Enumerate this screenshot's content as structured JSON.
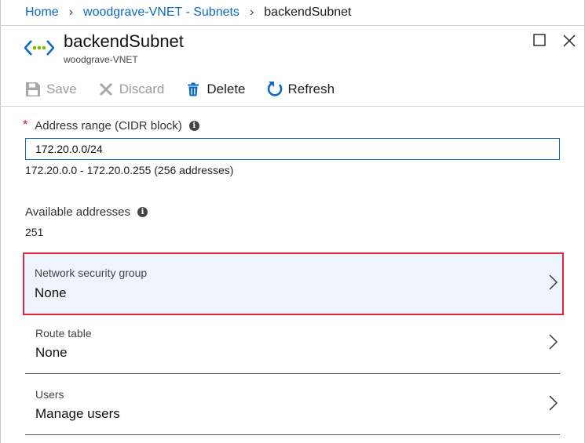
{
  "breadcrumb": {
    "items": [
      "Home",
      "woodgrave-VNET - Subnets",
      "backendSubnet"
    ]
  },
  "header": {
    "title": "backendSubnet",
    "subtitle": "woodgrave-VNET"
  },
  "toolbar": {
    "save_label": "Save",
    "discard_label": "Discard",
    "delete_label": "Delete",
    "refresh_label": "Refresh"
  },
  "address_range": {
    "label": "Address range (CIDR block)",
    "required_mark": "*",
    "info": "i",
    "value": "172.20.0.0/24",
    "range_text": "172.20.0.0 - 172.20.0.255 (256 addresses)"
  },
  "available": {
    "label": "Available addresses",
    "info": "i",
    "value": "251"
  },
  "rows": [
    {
      "label": "Network security group",
      "value": "None"
    },
    {
      "label": "Route table",
      "value": "None"
    },
    {
      "label": "Users",
      "value": "Manage users"
    }
  ],
  "colors": {
    "accent": "#0b6ac4",
    "highlight_border": "#e0263a",
    "highlight_bg": "#eef4fc",
    "vnet_icon_green": "#7fba00"
  }
}
